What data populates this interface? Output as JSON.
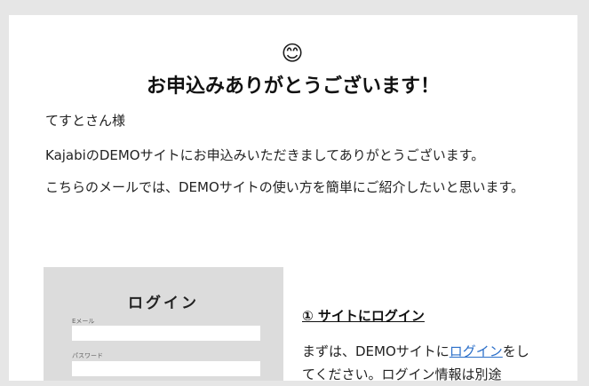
{
  "email": {
    "emoji": "😊",
    "headline": "お申込みありがとうございます！",
    "greeting": "てすとさん様",
    "thanks": "KajabiのDEMOサイトにお申込みいただきましてありがとうございます。",
    "intro": "こちらのメールでは、DEMOサイトの使い方を簡単にご紹介したいと思います。"
  },
  "login_image": {
    "title": "ログイン",
    "email_label": "Eメール",
    "password_label": "パスワード"
  },
  "step1": {
    "title": "① サイトにログイン",
    "text_before": "まずは、DEMOサイトに",
    "link_text": "ログイン",
    "text_after": "をしてください。ログイン情報は別途"
  },
  "colors": {
    "background": "#e6e6e6",
    "card": "#ffffff",
    "link": "#2b6fc9"
  }
}
